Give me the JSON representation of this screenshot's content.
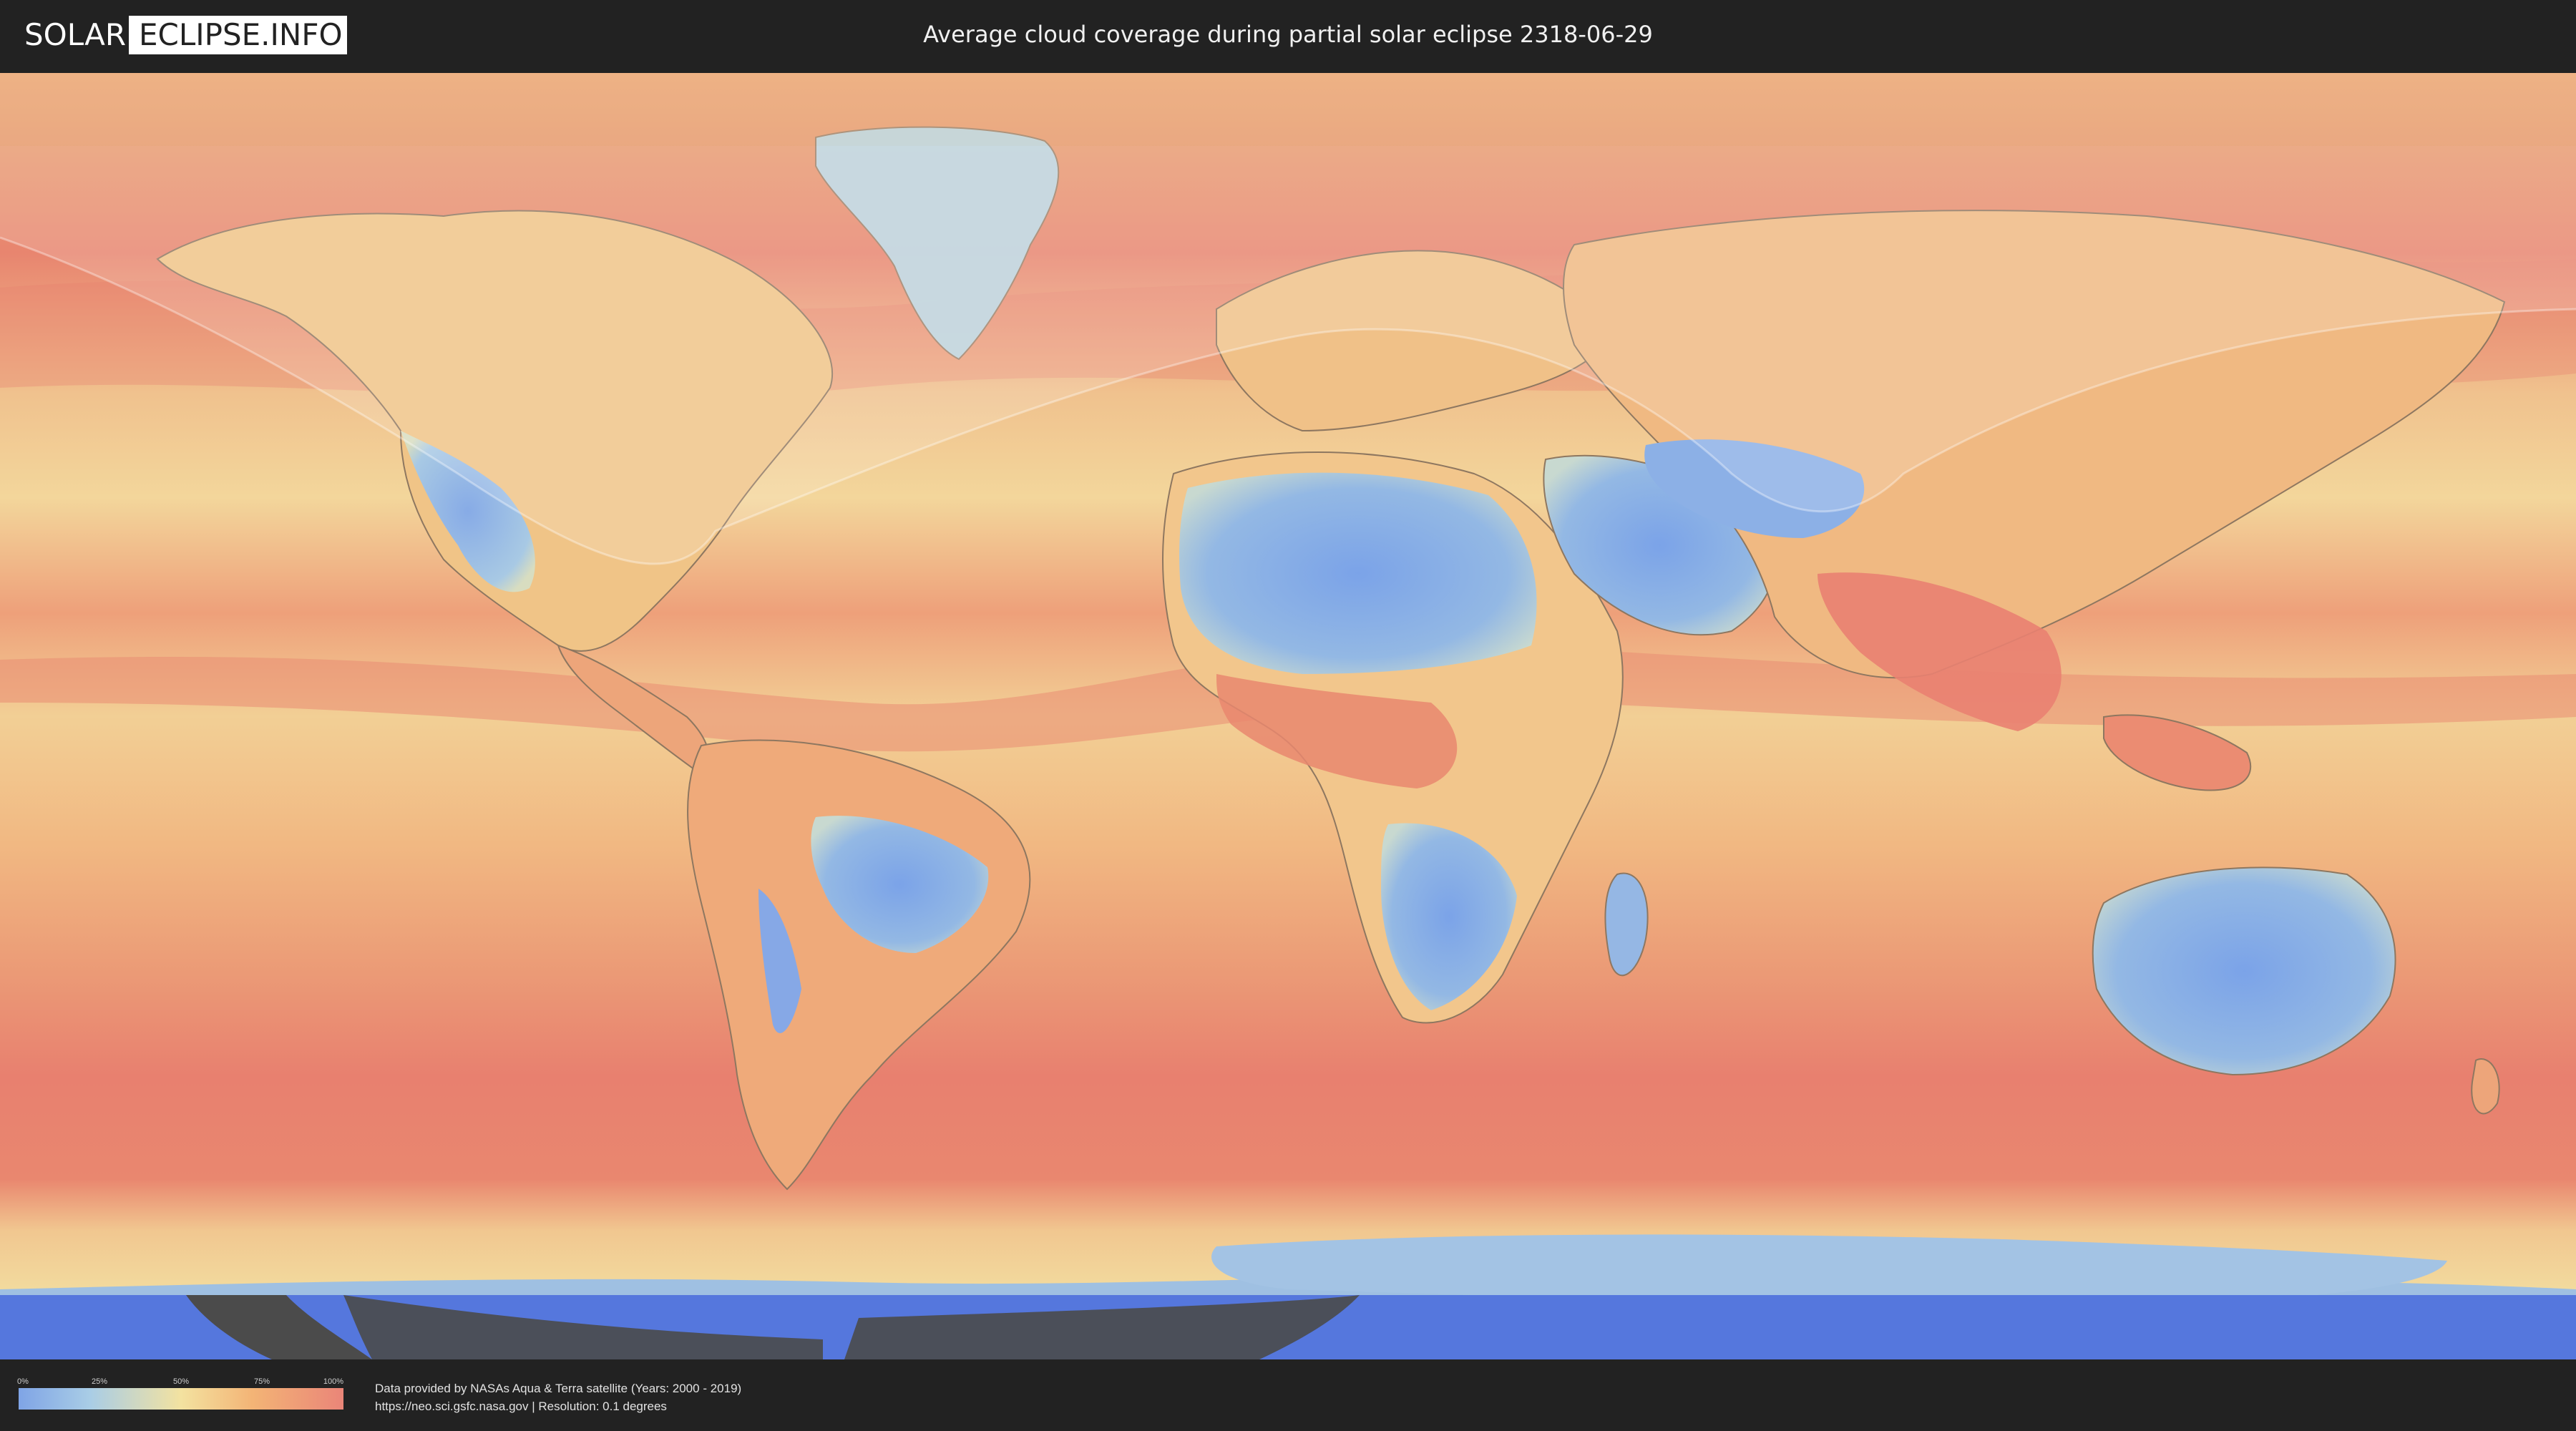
{
  "header": {
    "logo_part1": "SOLAR",
    "logo_part2": "ECLIPSE.INFO",
    "title": "Average cloud coverage during partial solar eclipse 2318-06-29"
  },
  "map": {
    "projection": "equirectangular",
    "layer": "average-cloud-coverage",
    "eclipse_type": "partial",
    "colors": {
      "low_cloud": "#7fa4e6",
      "mid_cloud": "#f3e2a0",
      "high_cloud": "#ea8578",
      "antarctic_ice": "#4f72dc",
      "background": "#222222"
    }
  },
  "legend": {
    "ticks": [
      "0%",
      "25%",
      "50%",
      "75%",
      "100%"
    ],
    "tick_values": [
      0,
      25,
      50,
      75,
      100
    ]
  },
  "credits": {
    "line1": "Data provided by NASAs Aqua & Terra satellite (Years: 2000 - 2019)",
    "line2": "https://neo.sci.gsfc.nasa.gov | Resolution: 0.1 degrees"
  }
}
